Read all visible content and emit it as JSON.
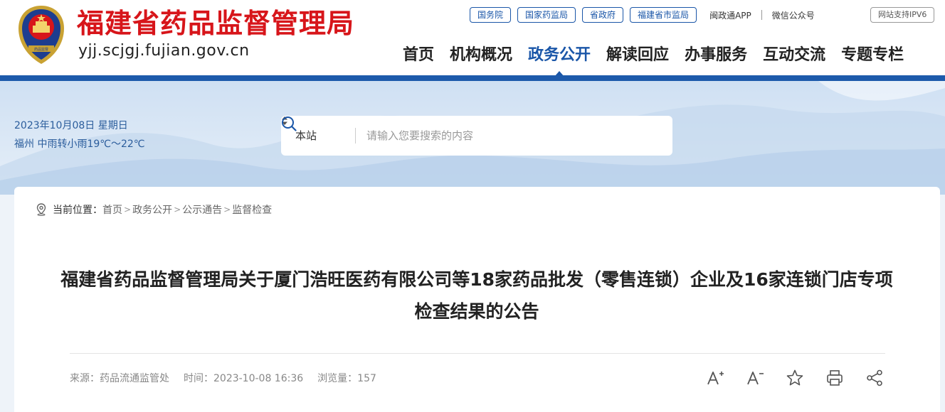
{
  "header": {
    "site_title": "福建省药品监督管理局",
    "site_domain": "yjj.scjgj.fujian.gov.cn",
    "top_links": {
      "gov_council": "国务院",
      "nmpa": "国家药监局",
      "province_gov": "省政府",
      "fujian_samr": "福建省市监局",
      "min_app": "闽政通APP",
      "wechat": "微信公众号",
      "ipv6": "网站支持IPV6"
    },
    "nav": [
      {
        "label": "首页"
      },
      {
        "label": "机构概况"
      },
      {
        "label": "政务公开"
      },
      {
        "label": "解读回应"
      },
      {
        "label": "办事服务"
      },
      {
        "label": "互动交流"
      },
      {
        "label": "专题专栏"
      }
    ],
    "active_nav": "政务公开",
    "brand_color": "#d7151a",
    "accent_color": "#1a56a8"
  },
  "banner": {
    "date": "2023年10月08日 星期日",
    "weather": "福州 中雨转小雨19℃～22℃",
    "search": {
      "scope": "本站",
      "placeholder": "请输入您要搜索的内容"
    }
  },
  "breadcrumb": {
    "label": "当前位置：",
    "items": [
      "首页",
      "政务公开",
      "公示通告",
      "监督检查"
    ]
  },
  "article": {
    "title": "福建省药品监督管理局关于厦门浩旺医药有限公司等18家药品批发（零售连锁）企业及16家连锁门店专项检查结果的公告",
    "source": "来源：药品流通监管处",
    "time": "时间：2023-10-08 16:36",
    "views": "浏览量：157",
    "tools": [
      "font-increase-icon",
      "font-decrease-icon",
      "star-icon",
      "print-icon",
      "share-icon"
    ]
  }
}
